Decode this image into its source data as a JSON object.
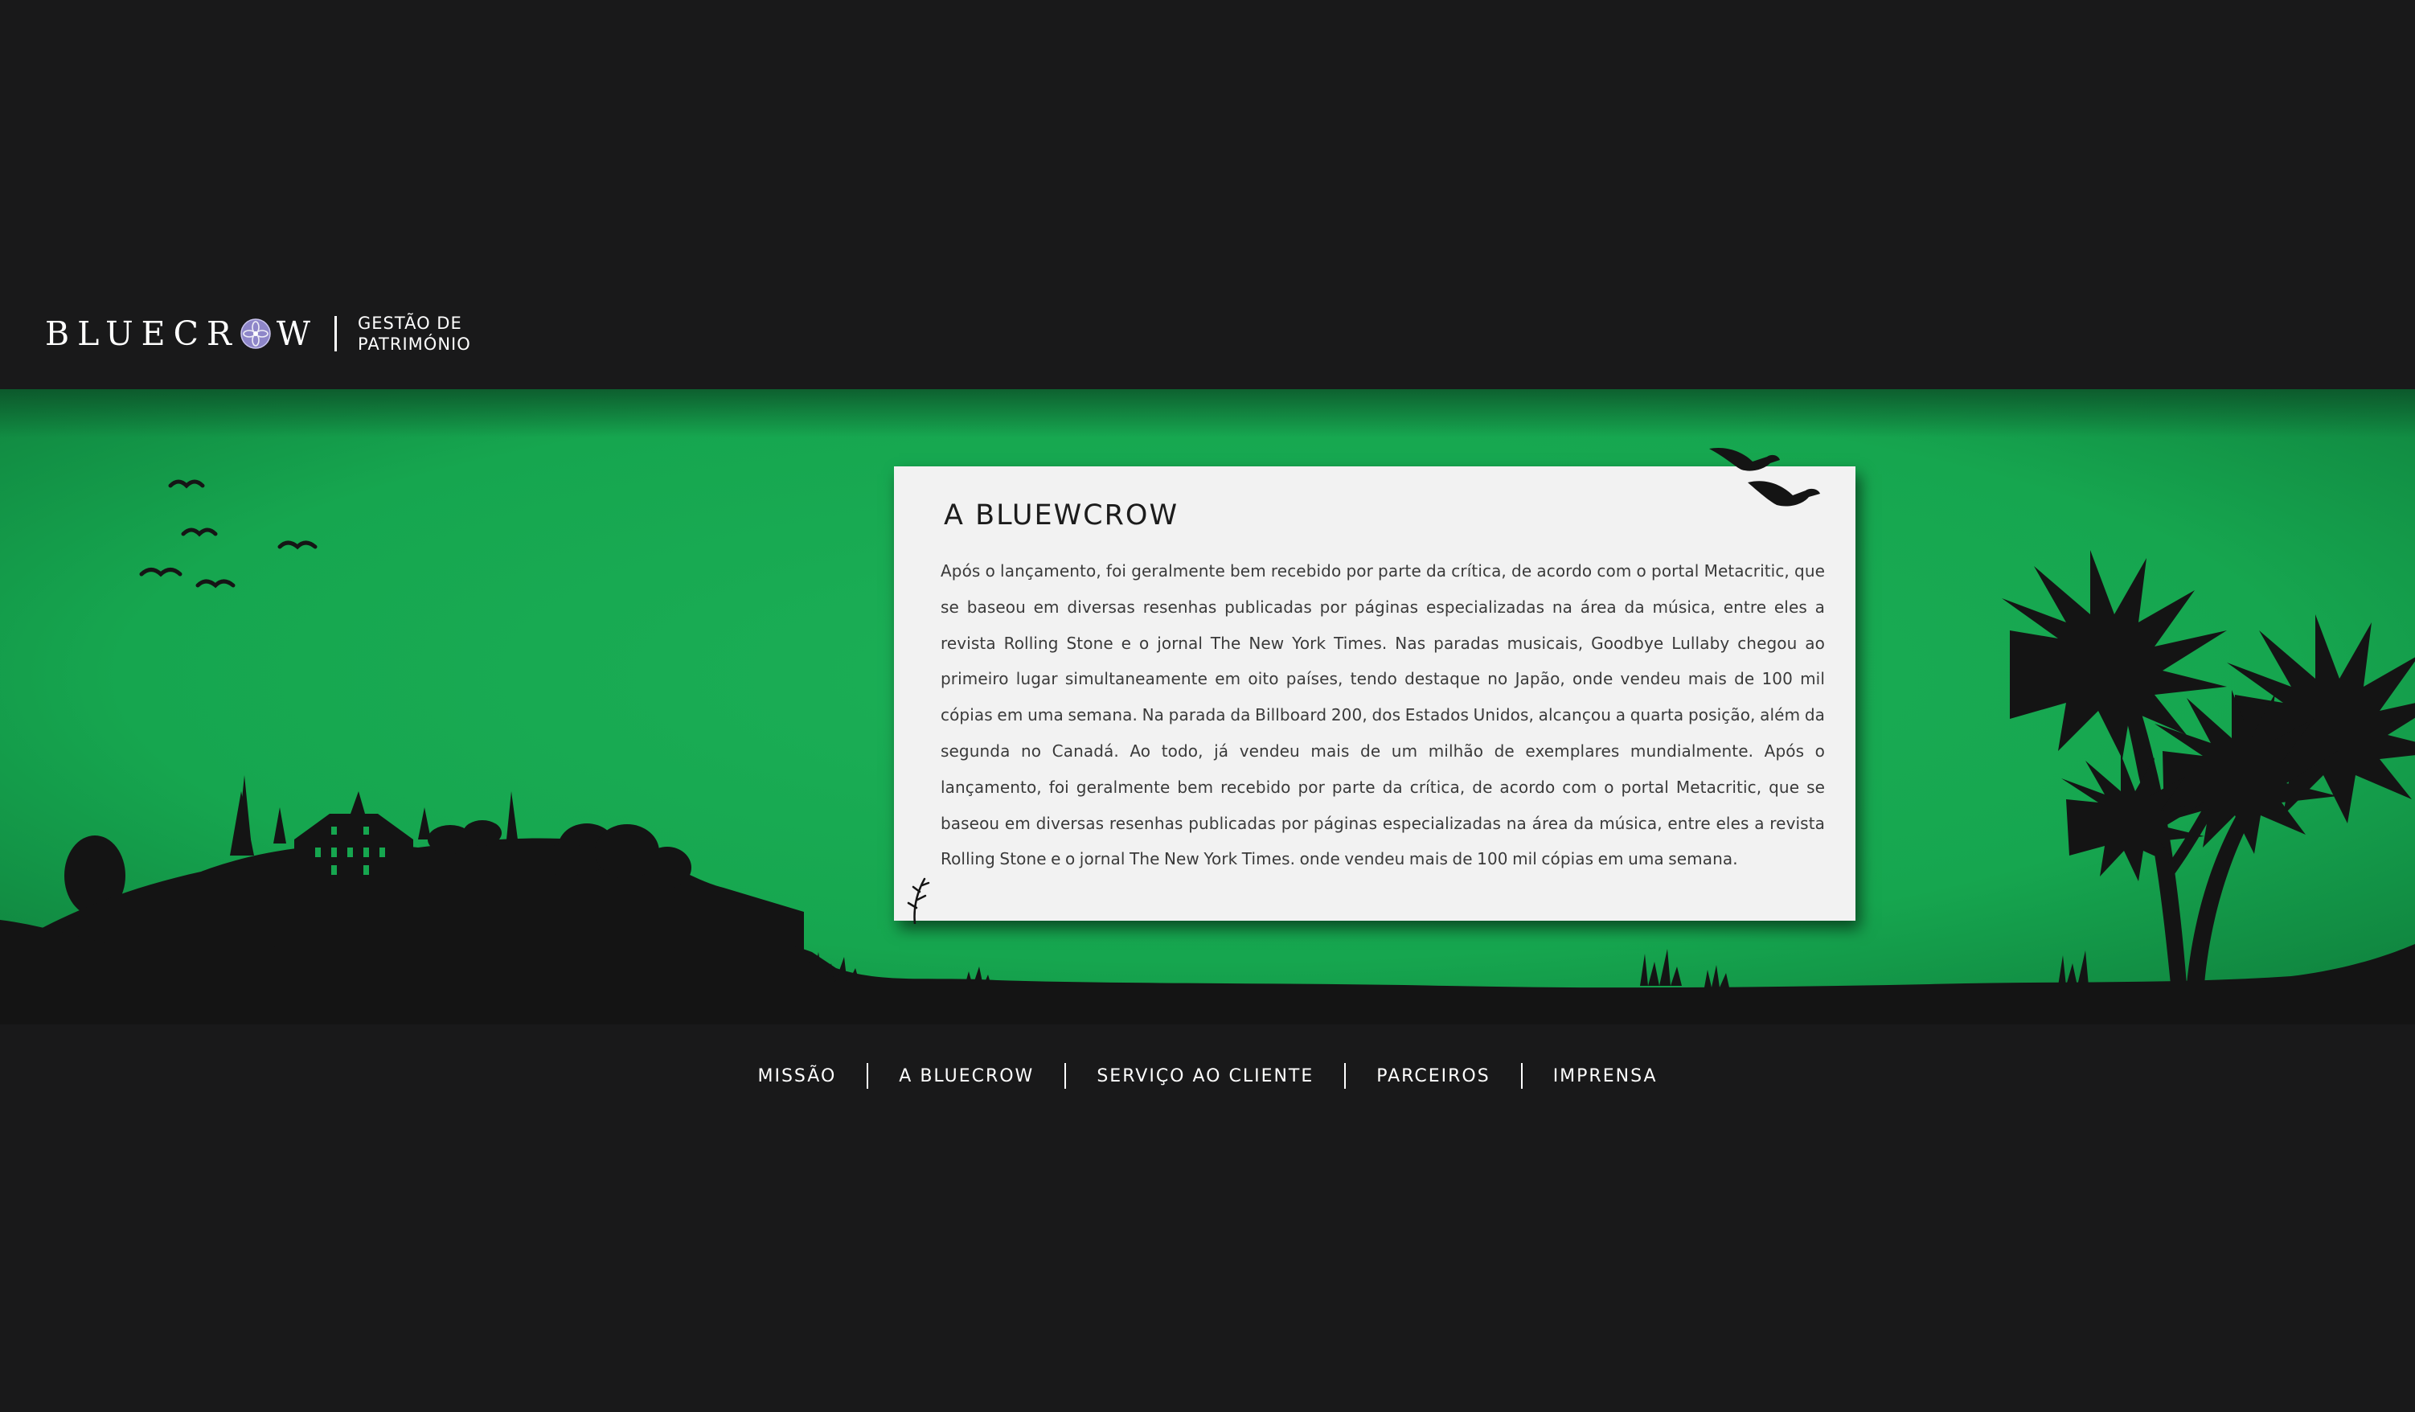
{
  "brand": {
    "name_part1": "BLUEC",
    "name_part2": "R",
    "name_part3": "W",
    "tagline_line1": "GESTÃO DE",
    "tagline_line2": "PATRIMÓNIO",
    "emblem_icon": "flower-emblem-icon",
    "emblem_color": "#8e86c9"
  },
  "colors": {
    "background": "#19191a",
    "hero_green": "#16a64f",
    "silhouette": "#141414",
    "card_background": "#f2f2f2"
  },
  "card": {
    "title": "A BLUEWCROW",
    "body": "Após o lançamento, foi geralmente bem recebido por parte da crítica, de acordo com o portal Metacritic, que se baseou em diversas resenhas publicadas por páginas especializadas na área da música, entre eles a revista Rolling Stone e o jornal The New York Times. Nas paradas musicais, Goodbye Lullaby chegou ao primeiro lugar simultaneamente em oito países, tendo destaque no Japão, onde vendeu mais de 100 mil cópias em uma semana. Na parada da Billboard 200, dos Estados Unidos, alcançou a quarta posição, além da segunda no Canadá. Ao todo, já vendeu mais de um milhão de exemplares mundialmente. Após o lançamento, foi geralmente bem recebido por parte da crítica, de acordo com o portal Metacritic, que se baseou em diversas resenhas publicadas por páginas especializadas na área da música, entre eles a revista Rolling Stone e o jornal The New York Times. onde vendeu mais de 100 mil cópias em uma semana."
  },
  "nav": {
    "items": [
      {
        "label": "MISSÃO"
      },
      {
        "label": "A BLUECROW"
      },
      {
        "label": "SERVIÇO AO CLIENTE"
      },
      {
        "label": "PARCEIROS"
      },
      {
        "label": "IMPRENSA"
      }
    ]
  }
}
